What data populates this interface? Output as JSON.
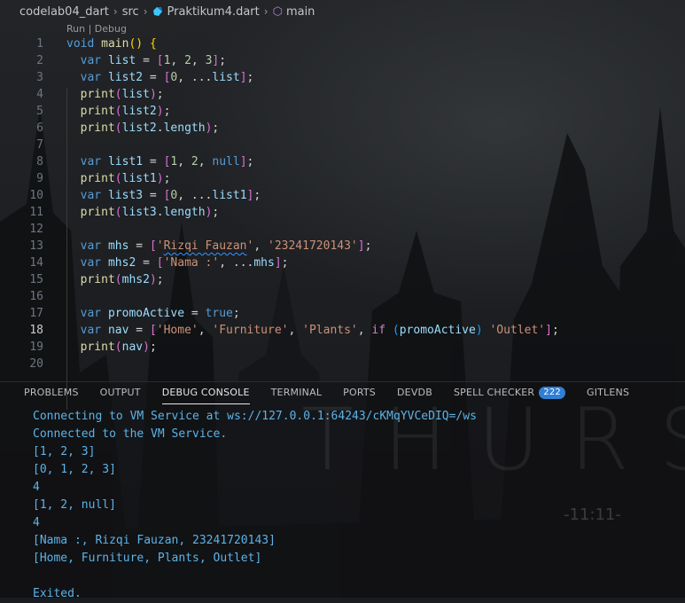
{
  "breadcrumb": {
    "items": [
      "codelab04_dart",
      "src",
      "Praktikum4.dart",
      "main"
    ],
    "separator": "›"
  },
  "codelens": "Run | Debug",
  "editor": {
    "active_line": 18,
    "lines": [
      {
        "n": "1",
        "tokens": [
          [
            "kw",
            "void"
          ],
          [
            "pun",
            " "
          ],
          [
            "fn",
            "main"
          ],
          [
            "br1",
            "()"
          ],
          [
            "pun",
            " "
          ],
          [
            "br1",
            "{"
          ]
        ]
      },
      {
        "n": "2",
        "tokens": [
          [
            "pun",
            "  "
          ],
          [
            "kw",
            "var"
          ],
          [
            "pun",
            " "
          ],
          [
            "var",
            "list"
          ],
          [
            "pun",
            " = "
          ],
          [
            "br2",
            "["
          ],
          [
            "num",
            "1"
          ],
          [
            "pun",
            ", "
          ],
          [
            "num",
            "2"
          ],
          [
            "pun",
            ", "
          ],
          [
            "num",
            "3"
          ],
          [
            "br2",
            "]"
          ],
          [
            "pun",
            ";"
          ]
        ]
      },
      {
        "n": "3",
        "tokens": [
          [
            "pun",
            "  "
          ],
          [
            "kw",
            "var"
          ],
          [
            "pun",
            " "
          ],
          [
            "var",
            "list2"
          ],
          [
            "pun",
            " = "
          ],
          [
            "br2",
            "["
          ],
          [
            "num",
            "0"
          ],
          [
            "pun",
            ", ..."
          ],
          [
            "var",
            "list"
          ],
          [
            "br2",
            "]"
          ],
          [
            "pun",
            ";"
          ]
        ]
      },
      {
        "n": "4",
        "tokens": [
          [
            "pun",
            "  "
          ],
          [
            "fn",
            "print"
          ],
          [
            "br2",
            "("
          ],
          [
            "var",
            "list"
          ],
          [
            "br2",
            ")"
          ],
          [
            "pun",
            ";"
          ]
        ]
      },
      {
        "n": "5",
        "tokens": [
          [
            "pun",
            "  "
          ],
          [
            "fn",
            "print"
          ],
          [
            "br2",
            "("
          ],
          [
            "var",
            "list2"
          ],
          [
            "br2",
            ")"
          ],
          [
            "pun",
            ";"
          ]
        ]
      },
      {
        "n": "6",
        "tokens": [
          [
            "pun",
            "  "
          ],
          [
            "fn",
            "print"
          ],
          [
            "br2",
            "("
          ],
          [
            "var",
            "list2"
          ],
          [
            "pun",
            "."
          ],
          [
            "var",
            "length"
          ],
          [
            "br2",
            ")"
          ],
          [
            "pun",
            ";"
          ]
        ]
      },
      {
        "n": "7",
        "tokens": []
      },
      {
        "n": "8",
        "tokens": [
          [
            "pun",
            "  "
          ],
          [
            "kw",
            "var"
          ],
          [
            "pun",
            " "
          ],
          [
            "var",
            "list1"
          ],
          [
            "pun",
            " = "
          ],
          [
            "br2",
            "["
          ],
          [
            "num",
            "1"
          ],
          [
            "pun",
            ", "
          ],
          [
            "num",
            "2"
          ],
          [
            "pun",
            ", "
          ],
          [
            "kw",
            "null"
          ],
          [
            "br2",
            "]"
          ],
          [
            "pun",
            ";"
          ]
        ]
      },
      {
        "n": "9",
        "tokens": [
          [
            "pun",
            "  "
          ],
          [
            "fn",
            "print"
          ],
          [
            "br2",
            "("
          ],
          [
            "var",
            "list1"
          ],
          [
            "br2",
            ")"
          ],
          [
            "pun",
            ";"
          ]
        ]
      },
      {
        "n": "10",
        "tokens": [
          [
            "pun",
            "  "
          ],
          [
            "kw",
            "var"
          ],
          [
            "pun",
            " "
          ],
          [
            "var",
            "list3"
          ],
          [
            "pun",
            " = "
          ],
          [
            "br2",
            "["
          ],
          [
            "num",
            "0"
          ],
          [
            "pun",
            ", ..."
          ],
          [
            "var",
            "list1"
          ],
          [
            "br2",
            "]"
          ],
          [
            "pun",
            ";"
          ]
        ]
      },
      {
        "n": "11",
        "tokens": [
          [
            "pun",
            "  "
          ],
          [
            "fn",
            "print"
          ],
          [
            "br2",
            "("
          ],
          [
            "var",
            "list3"
          ],
          [
            "pun",
            "."
          ],
          [
            "var",
            "length"
          ],
          [
            "br2",
            ")"
          ],
          [
            "pun",
            ";"
          ]
        ]
      },
      {
        "n": "12",
        "tokens": []
      },
      {
        "n": "13",
        "tokens": [
          [
            "pun",
            "  "
          ],
          [
            "kw",
            "var"
          ],
          [
            "pun",
            " "
          ],
          [
            "var",
            "mhs"
          ],
          [
            "pun",
            " = "
          ],
          [
            "br2",
            "["
          ],
          [
            "str",
            "'"
          ],
          [
            "strtypo",
            "Rizqi Fauzan"
          ],
          [
            "str",
            "'"
          ],
          [
            "pun",
            ", "
          ],
          [
            "str",
            "'23241720143'"
          ],
          [
            "br2",
            "]"
          ],
          [
            "pun",
            ";"
          ]
        ]
      },
      {
        "n": "14",
        "tokens": [
          [
            "pun",
            "  "
          ],
          [
            "kw",
            "var"
          ],
          [
            "pun",
            " "
          ],
          [
            "var",
            "mhs2"
          ],
          [
            "pun",
            " = "
          ],
          [
            "br2",
            "["
          ],
          [
            "str",
            "'Nama :'"
          ],
          [
            "pun",
            ", ..."
          ],
          [
            "var",
            "mhs"
          ],
          [
            "br2",
            "]"
          ],
          [
            "pun",
            ";"
          ]
        ]
      },
      {
        "n": "15",
        "tokens": [
          [
            "pun",
            "  "
          ],
          [
            "fn",
            "print"
          ],
          [
            "br2",
            "("
          ],
          [
            "var",
            "mhs2"
          ],
          [
            "br2",
            ")"
          ],
          [
            "pun",
            ";"
          ]
        ]
      },
      {
        "n": "16",
        "tokens": []
      },
      {
        "n": "17",
        "tokens": [
          [
            "pun",
            "  "
          ],
          [
            "kw",
            "var"
          ],
          [
            "pun",
            " "
          ],
          [
            "var",
            "promoActive"
          ],
          [
            "pun",
            " = "
          ],
          [
            "kw",
            "true"
          ],
          [
            "pun",
            ";"
          ]
        ]
      },
      {
        "n": "18",
        "tokens": [
          [
            "pun",
            "  "
          ],
          [
            "kw",
            "var"
          ],
          [
            "pun",
            " "
          ],
          [
            "var",
            "nav"
          ],
          [
            "pun",
            " = "
          ],
          [
            "br2",
            "["
          ],
          [
            "str",
            "'Home'"
          ],
          [
            "pun",
            ", "
          ],
          [
            "str",
            "'Furniture'"
          ],
          [
            "pun",
            ", "
          ],
          [
            "str",
            "'Plants'"
          ],
          [
            "pun",
            ", "
          ],
          [
            "ctl",
            "if"
          ],
          [
            "pun",
            " "
          ],
          [
            "br3",
            "("
          ],
          [
            "var",
            "promoActive"
          ],
          [
            "br3",
            ")"
          ],
          [
            "pun",
            " "
          ],
          [
            "str",
            "'Outlet'"
          ],
          [
            "br2",
            "]"
          ],
          [
            "pun",
            ";"
          ]
        ]
      },
      {
        "n": "19",
        "tokens": [
          [
            "pun",
            "  "
          ],
          [
            "fn",
            "print"
          ],
          [
            "br2",
            "("
          ],
          [
            "var",
            "nav"
          ],
          [
            "br2",
            ")"
          ],
          [
            "pun",
            ";"
          ]
        ]
      },
      {
        "n": "20",
        "tokens": []
      }
    ]
  },
  "panel": {
    "tabs": [
      {
        "label": "PROBLEMS",
        "active": false
      },
      {
        "label": "OUTPUT",
        "active": false
      },
      {
        "label": "DEBUG CONSOLE",
        "active": true
      },
      {
        "label": "TERMINAL",
        "active": false
      },
      {
        "label": "PORTS",
        "active": false
      },
      {
        "label": "DEVDB",
        "active": false
      },
      {
        "label": "SPELL CHECKER",
        "active": false,
        "badge": "222"
      },
      {
        "label": "GITLENS",
        "active": false
      }
    ],
    "console_lines": [
      "Connecting to VM Service at ws://127.0.0.1:64243/cKMqYVCeDIQ=/ws",
      "Connected to the VM Service.",
      "[1, 2, 3]",
      "[0, 1, 2, 3]",
      "4",
      "[1, 2, null]",
      "4",
      "[Nama :, Rizqi Fauzan, 23241720143]",
      "[Home, Furniture, Plants, Outlet]",
      "",
      "Exited."
    ]
  },
  "wallpaper": {
    "watermark": "THURS",
    "clock": "-11:11-"
  },
  "colors": {
    "console_text": "#5cb3e8",
    "keyword": "#569cd6",
    "string": "#ce9178",
    "badge": "#2f7fd6"
  }
}
